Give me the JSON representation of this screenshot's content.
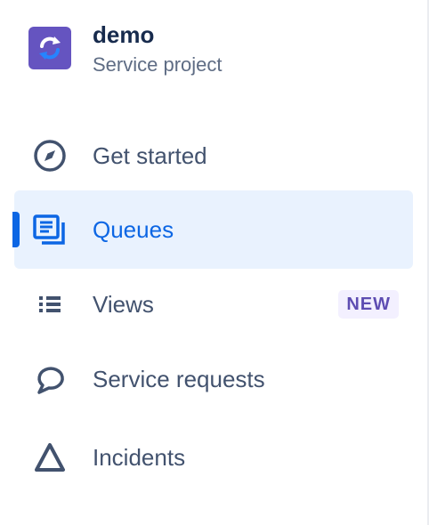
{
  "project": {
    "name": "demo",
    "type": "Service project",
    "avatar_color": "#6554c0"
  },
  "nav": {
    "items": [
      {
        "label": "Get started",
        "icon": "compass-icon",
        "active": false
      },
      {
        "label": "Queues",
        "icon": "queues-icon",
        "active": true
      },
      {
        "label": "Views",
        "icon": "list-icon",
        "active": false,
        "badge": "NEW"
      },
      {
        "label": "Service requests",
        "icon": "speech-bubble-icon",
        "active": false
      },
      {
        "label": "Incidents",
        "icon": "incident-triangle-icon",
        "active": false
      }
    ]
  },
  "colors": {
    "active_text": "#0c66e4",
    "active_bg": "#e9f2fe",
    "text": "#42526e",
    "badge_bg": "#f3f0ff",
    "badge_text": "#5e4db2"
  }
}
